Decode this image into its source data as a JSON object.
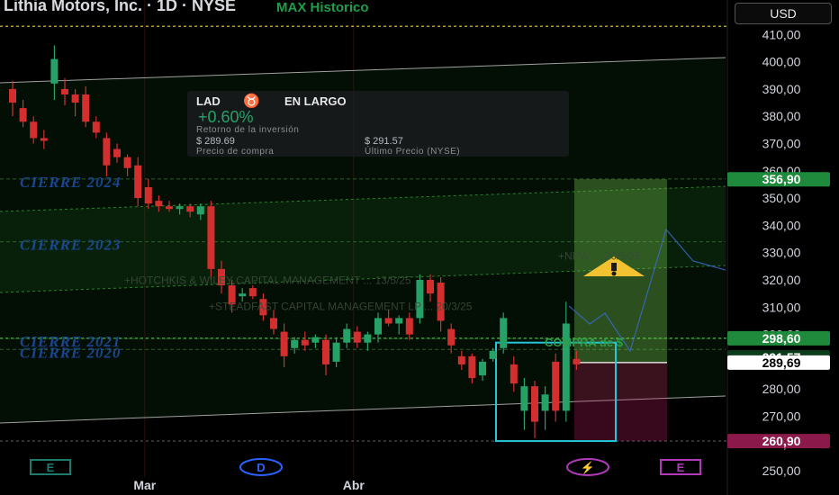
{
  "header": {
    "title": "Lithia Motors, Inc. · 1D · NYSE",
    "max_label": "MAX Historico",
    "currency_button": "USD"
  },
  "position_panel": {
    "ticker": "LAD",
    "bull_icon": "bull-icon",
    "side": "EN LARGO",
    "return_pct": "+0.60%",
    "return_label": "Retorno de la inversión",
    "buy_price": "$ 289.69",
    "buy_label": "Precio de compra",
    "last_price": "$ 291.57",
    "last_label": "Último Precio (NYSE)"
  },
  "chart_data": {
    "type": "candlestick",
    "ylim": [
      245,
      415
    ],
    "y_ticks": [
      250,
      260,
      270,
      280,
      290,
      300,
      310,
      320,
      330,
      340,
      350,
      360,
      370,
      380,
      390,
      400,
      410
    ],
    "y_tick_labels": [
      "250,00",
      "260,00",
      "270,00",
      "280,00",
      "290,00",
      "300,00",
      "310,00",
      "320,00",
      "330,00",
      "340,00",
      "350,00",
      "360,00",
      "370,00",
      "380,00",
      "390,00",
      "400,00",
      "410,00"
    ],
    "x_labels": [
      {
        "text": "Mar",
        "index": 13
      },
      {
        "text": "Abr",
        "index": 33
      }
    ],
    "candles": [
      {
        "o": 390,
        "h": 393,
        "l": 380,
        "c": 385
      },
      {
        "o": 383,
        "h": 386,
        "l": 376,
        "c": 378
      },
      {
        "o": 378,
        "h": 380,
        "l": 370,
        "c": 372
      },
      {
        "o": 372,
        "h": 375,
        "l": 368,
        "c": 371
      },
      {
        "o": 392,
        "h": 406,
        "l": 386,
        "c": 401
      },
      {
        "o": 390,
        "h": 394,
        "l": 384,
        "c": 388
      },
      {
        "o": 388,
        "h": 390,
        "l": 380,
        "c": 385
      },
      {
        "o": 388,
        "h": 391,
        "l": 376,
        "c": 378
      },
      {
        "o": 378,
        "h": 380,
        "l": 372,
        "c": 374
      },
      {
        "o": 372,
        "h": 374,
        "l": 358,
        "c": 362
      },
      {
        "o": 368,
        "h": 370,
        "l": 363,
        "c": 365
      },
      {
        "o": 365,
        "h": 366,
        "l": 358,
        "c": 361
      },
      {
        "o": 362,
        "h": 365,
        "l": 347,
        "c": 350
      },
      {
        "o": 354,
        "h": 357,
        "l": 346,
        "c": 348
      },
      {
        "o": 349,
        "h": 351,
        "l": 345,
        "c": 347
      },
      {
        "o": 347,
        "h": 349,
        "l": 345,
        "c": 346
      },
      {
        "o": 346,
        "h": 348,
        "l": 344,
        "c": 347
      },
      {
        "o": 347,
        "h": 348,
        "l": 343,
        "c": 345
      },
      {
        "o": 344,
        "h": 348,
        "l": 342,
        "c": 347
      },
      {
        "o": 347,
        "h": 349,
        "l": 320,
        "c": 324
      },
      {
        "o": 324,
        "h": 327,
        "l": 315,
        "c": 318
      },
      {
        "o": 318,
        "h": 320,
        "l": 308,
        "c": 311
      },
      {
        "o": 314,
        "h": 317,
        "l": 312,
        "c": 315
      },
      {
        "o": 317,
        "h": 318,
        "l": 313,
        "c": 314
      },
      {
        "o": 313,
        "h": 315,
        "l": 305,
        "c": 307
      },
      {
        "o": 306,
        "h": 309,
        "l": 300,
        "c": 302
      },
      {
        "o": 301,
        "h": 304,
        "l": 288,
        "c": 292
      },
      {
        "o": 295,
        "h": 299,
        "l": 293,
        "c": 298
      },
      {
        "o": 298,
        "h": 301,
        "l": 294,
        "c": 296
      },
      {
        "o": 297,
        "h": 300,
        "l": 295,
        "c": 299
      },
      {
        "o": 298,
        "h": 300,
        "l": 285,
        "c": 289
      },
      {
        "o": 290,
        "h": 299,
        "l": 288,
        "c": 297
      },
      {
        "o": 297,
        "h": 304,
        "l": 295,
        "c": 302
      },
      {
        "o": 301,
        "h": 303,
        "l": 295,
        "c": 297
      },
      {
        "o": 297,
        "h": 301,
        "l": 294,
        "c": 300
      },
      {
        "o": 300,
        "h": 308,
        "l": 297,
        "c": 306
      },
      {
        "o": 306,
        "h": 309,
        "l": 303,
        "c": 304
      },
      {
        "o": 304,
        "h": 307,
        "l": 300,
        "c": 306
      },
      {
        "o": 306,
        "h": 308,
        "l": 298,
        "c": 300
      },
      {
        "o": 306,
        "h": 322,
        "l": 304,
        "c": 320
      },
      {
        "o": 320,
        "h": 322,
        "l": 312,
        "c": 315
      },
      {
        "o": 319,
        "h": 321,
        "l": 301,
        "c": 305
      },
      {
        "o": 302,
        "h": 304,
        "l": 293,
        "c": 296
      },
      {
        "o": 292,
        "h": 294,
        "l": 287,
        "c": 289
      },
      {
        "o": 292,
        "h": 293,
        "l": 282,
        "c": 284
      },
      {
        "o": 285,
        "h": 291,
        "l": 283,
        "c": 290
      },
      {
        "o": 291,
        "h": 295,
        "l": 290,
        "c": 294
      },
      {
        "o": 295,
        "h": 308,
        "l": 293,
        "c": 306
      },
      {
        "o": 289,
        "h": 292,
        "l": 279,
        "c": 282
      },
      {
        "o": 272,
        "h": 284,
        "l": 265,
        "c": 281
      },
      {
        "o": 281,
        "h": 283,
        "l": 262,
        "c": 268
      },
      {
        "o": 272,
        "h": 281,
        "l": 265,
        "c": 278
      },
      {
        "o": 290,
        "h": 293,
        "l": 268,
        "c": 272
      },
      {
        "o": 272,
        "h": 312,
        "l": 268,
        "c": 304
      },
      {
        "o": 291,
        "h": 294,
        "l": 287,
        "c": 289
      }
    ],
    "levels": [
      {
        "name": "max-historico",
        "value": 413
      },
      {
        "name": "buy-line",
        "value": 298.6
      },
      {
        "name": "low-support",
        "value": 260.9
      }
    ],
    "zone_labels": [
      "CIERRE 2024",
      "CIERRE 2023",
      "CIERRE 2021",
      "CIERRE 2020"
    ],
    "zone_label_values": [
      356,
      333,
      297.5,
      293.5
    ],
    "institution_labels": [
      "+HOTCHKIS & WILEY CAPITAL MANAGEMENT ... 13/5/25",
      "+STEADFAST CAPITAL MANAGEMENT LP ... 20/3/25",
      "+NEW ... 20/5/25"
    ],
    "institution_values": [
      318.5,
      309,
      327.5
    ],
    "compra_label": "COMPRA de $",
    "price_tags": [
      {
        "label": "356,90",
        "value": 356.9,
        "bg": "#1f8a3b",
        "fg": "#ffffff"
      },
      {
        "label": "298,60",
        "value": 298.6,
        "bg": "#1f8a3b",
        "fg": "#ffffff"
      },
      {
        "label": "291,57",
        "value": 291.57,
        "bg": "#0d3b1e",
        "fg": "#ffffff"
      },
      {
        "label": "289,69",
        "value": 289.69,
        "bg": "#ffffff",
        "fg": "#000000"
      },
      {
        "label": "260,90",
        "value": 260.9,
        "bg": "#8b1a4a",
        "fg": "#ffffff"
      }
    ],
    "target_top": 356.9,
    "entry": 289.69,
    "stop": 260.9,
    "event_markers": [
      {
        "letter": "E",
        "type": "earnings-past",
        "index": 3
      },
      {
        "letter": "D",
        "type": "dividend",
        "index": 16
      },
      {
        "letter": "⚡",
        "type": "split",
        "index": 53
      },
      {
        "letter": "E",
        "type": "earnings-upcoming",
        "index": 62
      }
    ],
    "colors": {
      "up": "#26a269",
      "down": "#d32f2f",
      "grid": "#151515",
      "axis_text": "#d1d4dc"
    }
  }
}
